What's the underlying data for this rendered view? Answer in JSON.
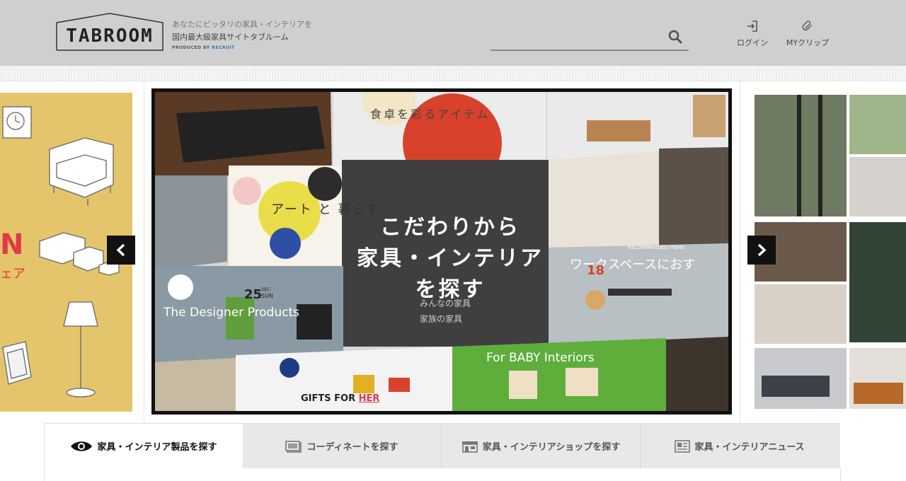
{
  "header": {
    "logo_text": "TABROOM",
    "tagline_line1": "あなたにピッタリの家具・インテリアを",
    "tagline_line2": "国内最大級家具サイトタブルーム",
    "produced_by": "PRODUCED BY",
    "produced_brand": "RECRUIT",
    "search_placeholder": "",
    "login_label": "ログイン",
    "myclip_label": "MYクリップ",
    "icons": {
      "search": "search-icon",
      "login": "login-icon",
      "clip": "paperclip-icon"
    }
  },
  "carousel": {
    "left_slide_text_large": "N",
    "left_slide_text_small": "ェア",
    "main_overlay_lines": [
      "こだわりから",
      "家具・インテリア",
      "を探す"
    ],
    "collage_texts": {
      "table_items": "食卓を彩るアイテム",
      "art": "アート と 暮らす",
      "designer": "The Designer Products",
      "recommended": "RECOMMENDED ITEMS",
      "workspace": "ワークスペースにおす",
      "family": [
        "みんなの家具",
        "家族の家具"
      ],
      "baby": "For BABY Interiors",
      "gifts_prefix": "GIFTS FOR ",
      "gifts_highlight": "HER",
      "calendar_day": "25",
      "calendar_weekday": "SUN",
      "calendar_month": "DEC",
      "workspace_calendar_day": "18"
    },
    "icons": {
      "prev": "chevron-left-icon",
      "next": "chevron-right-icon"
    },
    "accent_red": "#e03a45"
  },
  "tabs": [
    {
      "label": "家具・インテリア製品を探す",
      "icon": "eye-icon",
      "active": true
    },
    {
      "label": "コーディネートを探す",
      "icon": "photo-frame-icon",
      "active": false
    },
    {
      "label": "家具・インテリアショップを探す",
      "icon": "shop-icon",
      "active": false
    },
    {
      "label": "家具・インテリアニュース",
      "icon": "newspaper-icon",
      "active": false
    }
  ]
}
